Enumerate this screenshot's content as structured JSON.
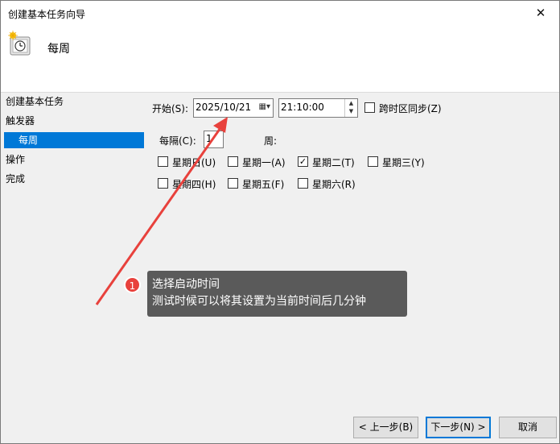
{
  "window": {
    "title": "创建基本任务向导",
    "close_icon": "close-icon"
  },
  "header": {
    "title": "每周",
    "icon": "task-scheduler-clock-icon"
  },
  "nav": {
    "items": [
      {
        "label": "创建基本任务",
        "selected": false
      },
      {
        "label": "触发器",
        "selected": false
      },
      {
        "label": "每周",
        "selected": true
      },
      {
        "label": "操作",
        "selected": false
      },
      {
        "label": "完成",
        "selected": false
      }
    ]
  },
  "form": {
    "start_label": "开始(S):",
    "start_date": "2025/10/21",
    "start_time": "21:10:00",
    "sync_timezone_label": "跨时区同步(Z)",
    "sync_timezone_checked": false,
    "recur_label": "每隔(C):",
    "recur_value": "1",
    "recur_unit": "周:",
    "days": [
      {
        "label": "星期日(U)",
        "checked": false
      },
      {
        "label": "星期一(A)",
        "checked": false
      },
      {
        "label": "星期二(T)",
        "checked": true
      },
      {
        "label": "星期三(Y)",
        "checked": false
      },
      {
        "label": "星期四(H)",
        "checked": false
      },
      {
        "label": "星期五(F)",
        "checked": false
      },
      {
        "label": "星期六(R)",
        "checked": false
      }
    ]
  },
  "buttons": {
    "back": "< 上一步(B)",
    "next": "下一步(N) >",
    "cancel": "取消"
  },
  "annotation": {
    "number": "1",
    "line1": "选择启动时间",
    "line2": "测试时候可以将其设置为当前时间后几分钟",
    "color": "#e8413c"
  },
  "colors": {
    "selection": "#0078d7",
    "primary_border": "#0078d7"
  }
}
